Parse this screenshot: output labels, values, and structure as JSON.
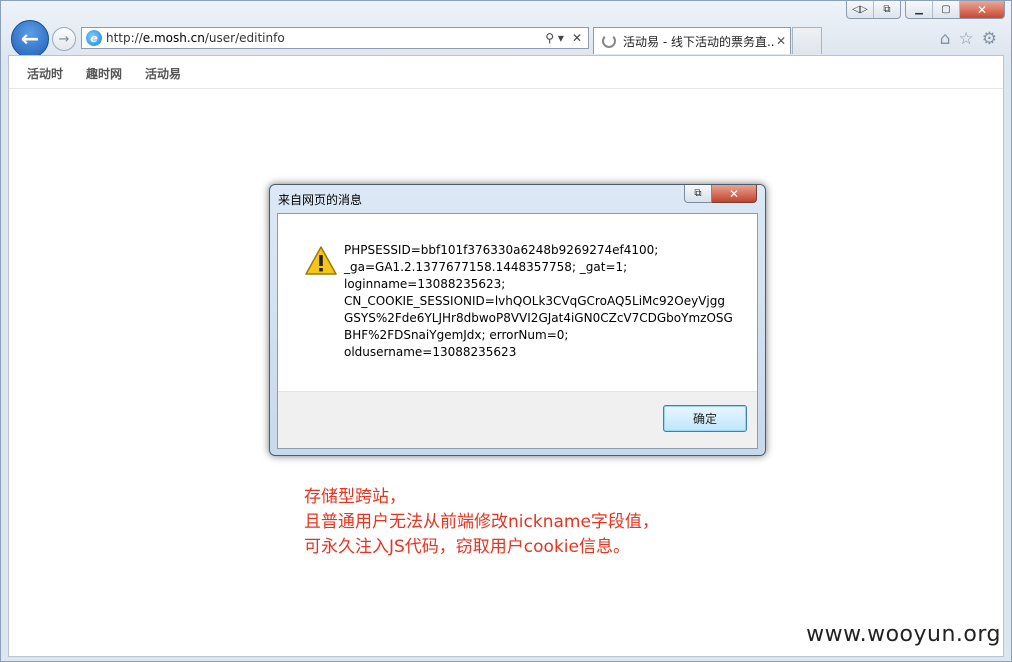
{
  "browser": {
    "url_prefix": "http://",
    "url_host": "e.mosh.cn",
    "url_path": "/user/editinfo",
    "tab_title": "活动易 - 线下活动的票务直...",
    "tab_close": "✕",
    "icons": [
      "back-arrow-icon",
      "forward-arrow-icon",
      "ie-logo-icon",
      "search-icon",
      "refresh-icon",
      "home-icon",
      "star-icon",
      "gear-icon"
    ]
  },
  "site_nav": {
    "items": [
      "活动时",
      "趣时网",
      "活动易"
    ]
  },
  "dialog": {
    "title": "来自网页的消息",
    "message_lines": [
      "PHPSESSID=bbf101f376330a6248b9269274ef4100;",
      "_ga=GA1.2.1377677158.1448357758; _gat=1;",
      "loginname=13088235623;",
      "CN_COOKIE_SESSIONID=lvhQOLk3CVqGCroAQ5LiMc92OeyVjgg",
      "GSYS%2Fde6YLJHr8dbwoP8VVI2GJat4iGN0CZcV7CDGboYmzOSG",
      "BHF%2FDSnaiYgemJdx; errorNum=0;",
      "oldusername=13088235623"
    ],
    "ok_label": "确定",
    "icon": "warning-icon"
  },
  "annotation": {
    "lines": [
      "存储型跨站，",
      "且普通用户无法从前端修改nickname字段值，",
      "可永久注入JS代码，窃取用户cookie信息。"
    ],
    "color": "#e8331f"
  },
  "watermark": "www.wooyun.org"
}
